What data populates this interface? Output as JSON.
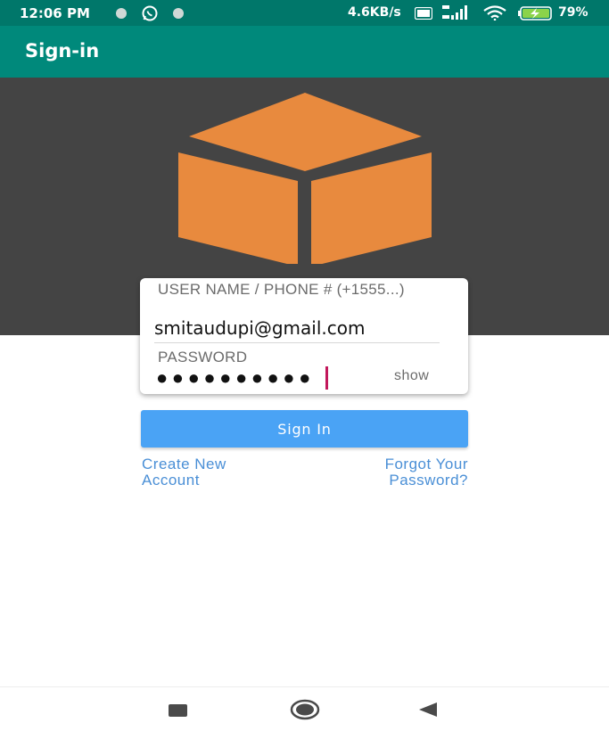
{
  "status_bar": {
    "time": "12:06 PM",
    "icons": [
      "notification-dot-icon",
      "whatsapp-icon",
      "notification-dot-icon"
    ],
    "net_speed": "4.6KB/s",
    "battery_pct": "79%"
  },
  "app_bar": {
    "title": "Sign-in"
  },
  "logo": {
    "icon": "box-icon",
    "color": "#e88a3e"
  },
  "form": {
    "username_label": "USER NAME / PHONE # (+1555...)",
    "username_value": "smitaudupi@gmail.com",
    "password_label": "PASSWORD",
    "password_masked": "●●●●●●●●●●",
    "show_label": "show"
  },
  "buttons": {
    "sign_in": "Sign In",
    "create_account": "Create New Account",
    "forgot_password": "Forgot Your Password?"
  },
  "colors": {
    "status_bar": "#00776a",
    "app_bar": "#00897b",
    "hero_bg": "#444444",
    "primary_button": "#4aa3f5",
    "link": "#4a8fd6",
    "caret": "#c2185b"
  },
  "nav_bar": {
    "icons": [
      "recent-apps-icon",
      "home-icon",
      "back-icon"
    ]
  }
}
